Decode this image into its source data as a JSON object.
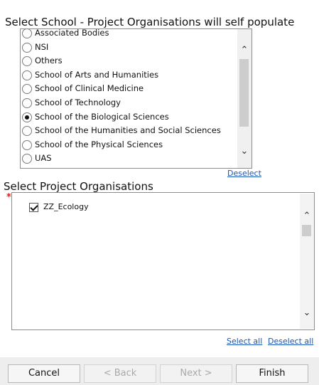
{
  "school": {
    "label": "Select School - Project Organisations will self populate",
    "options": [
      {
        "label": "Associated Bodies",
        "selected": false
      },
      {
        "label": "NSI",
        "selected": false
      },
      {
        "label": "Others",
        "selected": false
      },
      {
        "label": "School of Arts and Humanities",
        "selected": false
      },
      {
        "label": "School of Clinical Medicine",
        "selected": false
      },
      {
        "label": "School of Technology",
        "selected": false
      },
      {
        "label": "School of the Biological Sciences",
        "selected": true
      },
      {
        "label": "School of the Humanities and Social Sciences",
        "selected": false
      },
      {
        "label": "School of the Physical Sciences",
        "selected": false
      },
      {
        "label": "UAS",
        "selected": false
      }
    ],
    "deselect_label": "Deselect",
    "scroll_up_icon": "chevron-up-icon",
    "scroll_down_icon": "chevron-down-icon"
  },
  "organisations": {
    "label": "Select Project Organisations",
    "required_mark": "*",
    "items": [
      {
        "label": "ZZ_Ecology",
        "checked": true
      }
    ],
    "select_all_label": "Select all",
    "deselect_all_label": "Deselect all"
  },
  "footer": {
    "cancel_label": "Cancel",
    "back_label": "< Back",
    "next_label": "Next >",
    "finish_label": "Finish"
  },
  "colors": {
    "link": "#1a56b8",
    "required": "#e02020",
    "footer_bg": "#eeeeee"
  }
}
